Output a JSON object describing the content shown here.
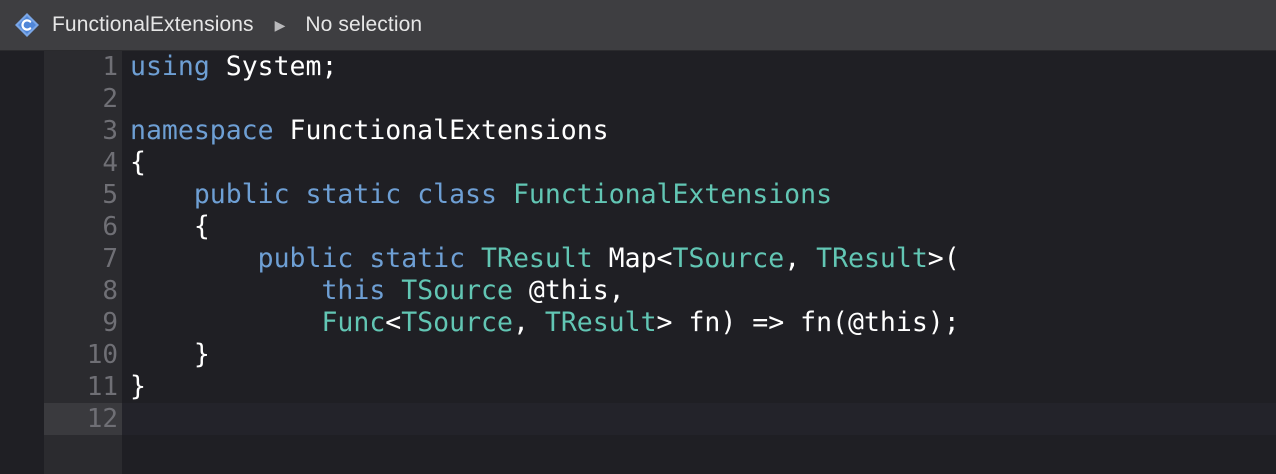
{
  "breadcrumb": {
    "file_icon": "csharp-file-icon",
    "file_name": "FunctionalExtensions",
    "separator_icon": "triangle-right-icon",
    "selection": "No selection"
  },
  "colors": {
    "keyword": "#6e9fd4",
    "type": "#62c6b4",
    "plain": "#ffffff",
    "line_number": "#6f6f75",
    "editor_bg": "#1f1f24",
    "gutter_bg": "#2b2b2f",
    "titlebar_bg": "#3e3e41"
  },
  "editor": {
    "current_line": "12",
    "lines": [
      {
        "num": "1",
        "t": [
          {
            "k": "kw",
            "v": "using"
          },
          {
            "k": "tx",
            "v": " System;"
          }
        ]
      },
      {
        "num": "2",
        "t": []
      },
      {
        "num": "3",
        "t": [
          {
            "k": "kw",
            "v": "namespace"
          },
          {
            "k": "tx",
            "v": " FunctionalExtensions"
          }
        ]
      },
      {
        "num": "4",
        "t": [
          {
            "k": "tx",
            "v": "{"
          }
        ]
      },
      {
        "num": "5",
        "t": [
          {
            "k": "tx",
            "v": "    "
          },
          {
            "k": "kw",
            "v": "public static class"
          },
          {
            "k": "tx",
            "v": " "
          },
          {
            "k": "ty",
            "v": "FunctionalExtensions"
          }
        ]
      },
      {
        "num": "6",
        "t": [
          {
            "k": "tx",
            "v": "    {"
          }
        ]
      },
      {
        "num": "7",
        "t": [
          {
            "k": "tx",
            "v": "        "
          },
          {
            "k": "kw",
            "v": "public static"
          },
          {
            "k": "tx",
            "v": " "
          },
          {
            "k": "ty",
            "v": "TResult"
          },
          {
            "k": "tx",
            "v": " Map<"
          },
          {
            "k": "ty",
            "v": "TSource"
          },
          {
            "k": "tx",
            "v": ", "
          },
          {
            "k": "ty",
            "v": "TResult"
          },
          {
            "k": "tx",
            "v": ">("
          }
        ]
      },
      {
        "num": "8",
        "t": [
          {
            "k": "tx",
            "v": "            "
          },
          {
            "k": "kw",
            "v": "this"
          },
          {
            "k": "tx",
            "v": " "
          },
          {
            "k": "ty",
            "v": "TSource"
          },
          {
            "k": "tx",
            "v": " @this,"
          }
        ]
      },
      {
        "num": "9",
        "t": [
          {
            "k": "tx",
            "v": "            "
          },
          {
            "k": "ty",
            "v": "Func"
          },
          {
            "k": "tx",
            "v": "<"
          },
          {
            "k": "ty",
            "v": "TSource"
          },
          {
            "k": "tx",
            "v": ", "
          },
          {
            "k": "ty",
            "v": "TResult"
          },
          {
            "k": "tx",
            "v": "> fn) => fn(@this);"
          }
        ]
      },
      {
        "num": "10",
        "t": [
          {
            "k": "tx",
            "v": "    }"
          }
        ]
      },
      {
        "num": "11",
        "t": [
          {
            "k": "tx",
            "v": "}"
          }
        ]
      },
      {
        "num": "12",
        "t": []
      }
    ]
  }
}
